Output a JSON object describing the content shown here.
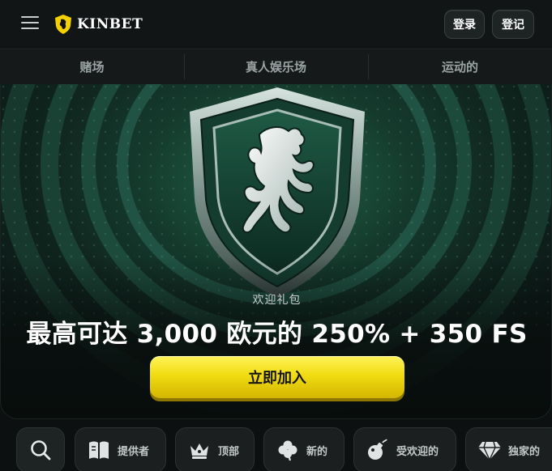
{
  "header": {
    "menu_icon": "hamburger-menu-icon",
    "logo_text": "KINBET",
    "login_label": "登录",
    "register_label": "登记"
  },
  "nav": {
    "tabs": [
      {
        "label": "赌场"
      },
      {
        "label": "真人娱乐场"
      },
      {
        "label": "运动的"
      }
    ]
  },
  "hero": {
    "emblem_icon": "lion-shield-icon",
    "promo_label": "欢迎礼包",
    "promo_title": "最高可达 3,000 欧元的 250% + 350 FS",
    "cta_label": "立即加入"
  },
  "categories": {
    "search_icon": "search-icon",
    "items": [
      {
        "label": "提供者",
        "icon": "book-icon"
      },
      {
        "label": "顶部",
        "icon": "crown-icon"
      },
      {
        "label": "新的",
        "icon": "clover-icon"
      },
      {
        "label": "受欢迎的",
        "icon": "bomb-icon"
      },
      {
        "label": "独家的",
        "icon": "diamond-icon"
      }
    ]
  },
  "colors": {
    "background": "#0d1010",
    "accent_yellow": "#f1dc12",
    "hero_green": "#1c4a3a"
  }
}
